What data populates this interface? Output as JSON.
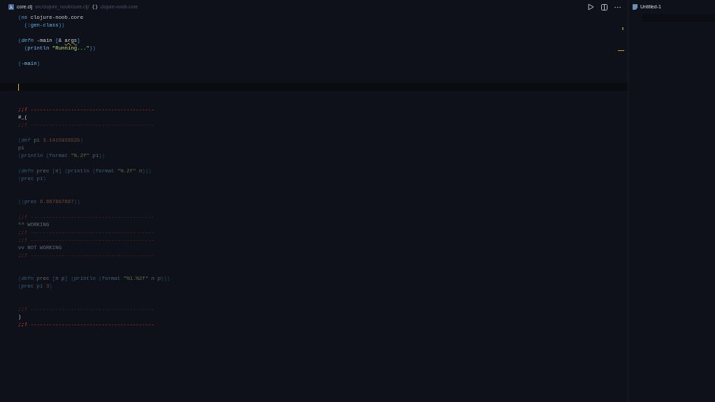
{
  "editor": {
    "tab": {
      "label": "core.clj",
      "selected": true
    },
    "breadcrumb": {
      "path": "src/clojure_noob/core.clj/",
      "symbol": "clojure-noob.core"
    },
    "lines": [
      {
        "kind": "code",
        "dimmed": false,
        "tokens": [
          {
            "text": "(",
            "kind": "paren1"
          },
          {
            "text": "ns",
            "kind": "special"
          },
          {
            "text": " clojure-noob.core",
            "kind": "sym"
          }
        ]
      },
      {
        "kind": "code",
        "dimmed": false,
        "tokens": [
          {
            "text": "  (",
            "kind": "paren2"
          },
          {
            "text": ":gen-class",
            "kind": "keyword"
          },
          {
            "text": ")",
            "kind": "paren2"
          },
          {
            "text": ")",
            "kind": "paren1"
          }
        ]
      },
      {
        "kind": "blank"
      },
      {
        "kind": "code",
        "dimmed": false,
        "tokens": [
          {
            "text": "(",
            "kind": "paren1"
          },
          {
            "text": "defn",
            "kind": "special"
          },
          {
            "text": " -main ",
            "kind": "sym"
          },
          {
            "text": "[",
            "kind": "paren2"
          },
          {
            "text": "& ",
            "kind": "sym"
          },
          {
            "text": "args",
            "kind": "warn"
          },
          {
            "text": "]",
            "kind": "paren2"
          }
        ]
      },
      {
        "kind": "code",
        "dimmed": false,
        "tokens": [
          {
            "text": "  (",
            "kind": "paren2"
          },
          {
            "text": "println ",
            "kind": "fn"
          },
          {
            "text": "\"Running...\"",
            "kind": "string"
          },
          {
            "text": ")",
            "kind": "paren2"
          },
          {
            "text": ")",
            "kind": "paren1"
          }
        ]
      },
      {
        "kind": "blank"
      },
      {
        "kind": "code",
        "dimmed": false,
        "tokens": [
          {
            "text": "(",
            "kind": "paren1"
          },
          {
            "text": "-main",
            "kind": "fn"
          },
          {
            "text": ")",
            "kind": "paren1"
          }
        ]
      },
      {
        "kind": "blank"
      },
      {
        "kind": "blank"
      },
      {
        "kind": "cursor"
      },
      {
        "kind": "blank"
      },
      {
        "kind": "blank"
      },
      {
        "kind": "code",
        "dimmed": false,
        "tokens": [
          {
            "text": ";;!",
            "kind": "marker"
          },
          {
            "text": " ----------------------------------------",
            "kind": "comment"
          }
        ]
      },
      {
        "kind": "code",
        "dimmed": false,
        "tokens": [
          {
            "text": "#_(",
            "kind": "sym"
          }
        ]
      },
      {
        "kind": "code",
        "dimmed": true,
        "tokens": [
          {
            "text": ";;!",
            "kind": "marker"
          },
          {
            "text": " ----------------------------------------",
            "kind": "comment"
          }
        ]
      },
      {
        "kind": "blank"
      },
      {
        "kind": "code",
        "dimmed": true,
        "tokens": [
          {
            "text": "(",
            "kind": "paren1"
          },
          {
            "text": "def",
            "kind": "special"
          },
          {
            "text": " pi ",
            "kind": "sym"
          },
          {
            "text": "3.1415926535",
            "kind": "number"
          },
          {
            "text": ")",
            "kind": "paren1"
          }
        ]
      },
      {
        "kind": "code",
        "dimmed": true,
        "tokens": [
          {
            "text": "pi",
            "kind": "sym"
          }
        ]
      },
      {
        "kind": "code",
        "dimmed": true,
        "tokens": [
          {
            "text": "(",
            "kind": "paren1"
          },
          {
            "text": "println ",
            "kind": "fn"
          },
          {
            "text": "(",
            "kind": "paren2"
          },
          {
            "text": "format ",
            "kind": "fn"
          },
          {
            "text": "\"%.2f\"",
            "kind": "string"
          },
          {
            "text": " pi",
            "kind": "sym"
          },
          {
            "text": ")",
            "kind": "paren2"
          },
          {
            "text": ")",
            "kind": "paren1"
          }
        ]
      },
      {
        "kind": "blank"
      },
      {
        "kind": "code",
        "dimmed": true,
        "tokens": [
          {
            "text": "(",
            "kind": "paren1"
          },
          {
            "text": "defn",
            "kind": "special"
          },
          {
            "text": " prec ",
            "kind": "sym"
          },
          {
            "text": "[",
            "kind": "paren2"
          },
          {
            "text": "n",
            "kind": "sym"
          },
          {
            "text": "] ",
            "kind": "paren2"
          },
          {
            "text": "(",
            "kind": "paren2"
          },
          {
            "text": "println ",
            "kind": "fn"
          },
          {
            "text": "(",
            "kind": "paren3"
          },
          {
            "text": "format ",
            "kind": "fn"
          },
          {
            "text": "\"%.2f\"",
            "kind": "string"
          },
          {
            "text": " n",
            "kind": "sym"
          },
          {
            "text": ")",
            "kind": "paren3"
          },
          {
            "text": ")",
            "kind": "paren2"
          },
          {
            "text": ")",
            "kind": "paren1"
          }
        ]
      },
      {
        "kind": "code",
        "dimmed": true,
        "tokens": [
          {
            "text": "(",
            "kind": "paren1"
          },
          {
            "text": "prec pi",
            "kind": "fn"
          },
          {
            "text": ")",
            "kind": "paren1"
          }
        ]
      },
      {
        "kind": "blank"
      },
      {
        "kind": "blank"
      },
      {
        "kind": "code",
        "dimmed": true,
        "tokens": [
          {
            "text": "(",
            "kind": "paren1"
          },
          {
            "text": "(",
            "kind": "paren1"
          },
          {
            "text": "prec ",
            "kind": "fn"
          },
          {
            "text": "6.667667667",
            "kind": "number"
          },
          {
            "text": ")",
            "kind": "paren1"
          },
          {
            "text": ")",
            "kind": "paren1"
          }
        ]
      },
      {
        "kind": "blank"
      },
      {
        "kind": "code",
        "dimmed": true,
        "tokens": [
          {
            "text": ";;!",
            "kind": "marker"
          },
          {
            "text": " ----------------------------------------",
            "kind": "comment"
          }
        ]
      },
      {
        "kind": "code",
        "dimmed": true,
        "tokens": [
          {
            "text": "^^ WORKING",
            "kind": "sym"
          }
        ]
      },
      {
        "kind": "code",
        "dimmed": true,
        "tokens": [
          {
            "text": ";;!",
            "kind": "marker"
          },
          {
            "text": " ----------------------------------------",
            "kind": "comment"
          }
        ]
      },
      {
        "kind": "code",
        "dimmed": true,
        "tokens": [
          {
            "text": ";;!",
            "kind": "marker"
          },
          {
            "text": " ----------------------------------------",
            "kind": "comment"
          }
        ]
      },
      {
        "kind": "code",
        "dimmed": true,
        "tokens": [
          {
            "text": "vv NOT WORKING",
            "kind": "sym"
          }
        ]
      },
      {
        "kind": "code",
        "dimmed": true,
        "tokens": [
          {
            "text": ";;!",
            "kind": "marker"
          },
          {
            "text": " ----------------------------------------",
            "kind": "comment"
          }
        ]
      },
      {
        "kind": "blank"
      },
      {
        "kind": "blank"
      },
      {
        "kind": "code",
        "dimmed": true,
        "tokens": [
          {
            "text": "(",
            "kind": "paren1"
          },
          {
            "text": "defn",
            "kind": "special"
          },
          {
            "text": " prec ",
            "kind": "sym"
          },
          {
            "text": "[",
            "kind": "paren2"
          },
          {
            "text": "n p",
            "kind": "sym"
          },
          {
            "text": "] ",
            "kind": "paren2"
          },
          {
            "text": "(",
            "kind": "paren2"
          },
          {
            "text": "println ",
            "kind": "fn"
          },
          {
            "text": "(",
            "kind": "paren3"
          },
          {
            "text": "format ",
            "kind": "fn"
          },
          {
            "text": "\"%1.%2f\"",
            "kind": "string"
          },
          {
            "text": " n p",
            "kind": "sym"
          },
          {
            "text": ")",
            "kind": "paren3"
          },
          {
            "text": ")",
            "kind": "paren2"
          },
          {
            "text": ")",
            "kind": "paren1"
          }
        ]
      },
      {
        "kind": "code",
        "dimmed": true,
        "tokens": [
          {
            "text": "(",
            "kind": "paren1"
          },
          {
            "text": "prec pi ",
            "kind": "fn"
          },
          {
            "text": "3",
            "kind": "number"
          },
          {
            "text": ")",
            "kind": "paren1"
          }
        ]
      },
      {
        "kind": "blank"
      },
      {
        "kind": "blank"
      },
      {
        "kind": "code",
        "dimmed": true,
        "tokens": [
          {
            "text": ";;!",
            "kind": "marker"
          },
          {
            "text": " ----------------------------------------",
            "kind": "comment"
          }
        ]
      },
      {
        "kind": "code",
        "dimmed": false,
        "tokens": [
          {
            "text": ")",
            "kind": "sym"
          }
        ]
      },
      {
        "kind": "code",
        "dimmed": false,
        "tokens": [
          {
            "text": ";;!",
            "kind": "marker"
          },
          {
            "text": " ----------------------------------------",
            "kind": "comment"
          }
        ]
      }
    ]
  },
  "side_editor": {
    "tab": {
      "label": "Untitled-1",
      "selected": true
    }
  }
}
